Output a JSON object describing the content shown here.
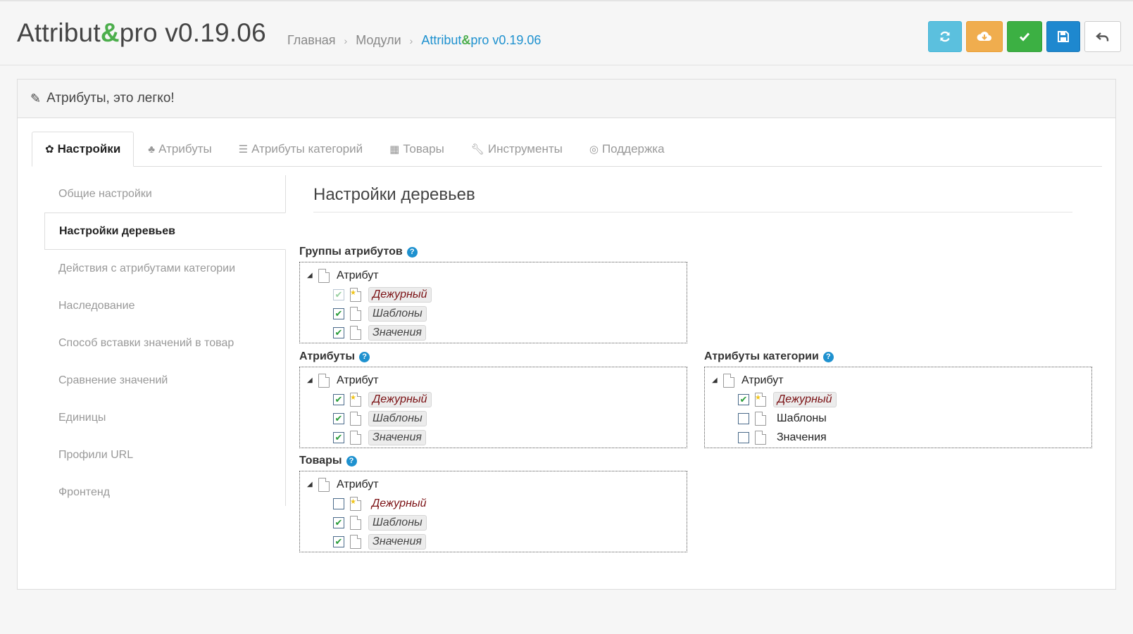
{
  "header": {
    "title_part1": "Attribut",
    "title_amp": "&",
    "title_part2": "pro v0.19.06",
    "breadcrumb": {
      "home": "Главная",
      "modules": "Модули",
      "current_part1": "Attribut",
      "current_amp": "&",
      "current_part2": "pro v0.19.06"
    },
    "toolbar": [
      {
        "icon": "refresh-icon",
        "color": "#5bc0de"
      },
      {
        "icon": "cloud-download-icon",
        "color": "#f0ad4e"
      },
      {
        "icon": "check-icon",
        "color": "#3cb043"
      },
      {
        "icon": "save-icon",
        "color": "#1e88cf"
      },
      {
        "icon": "back-icon",
        "color": "#ffffff"
      }
    ]
  },
  "panel": {
    "heading": "Атрибуты, это легко!"
  },
  "tabs": [
    {
      "label": "Настройки",
      "icon": "gear-icon",
      "active": true
    },
    {
      "label": "Атрибуты",
      "icon": "tree-icon"
    },
    {
      "label": "Атрибуты категорий",
      "icon": "list-icon"
    },
    {
      "label": "Товары",
      "icon": "grid-icon"
    },
    {
      "label": "Инструменты",
      "icon": "wrench-icon"
    },
    {
      "label": "Поддержка",
      "icon": "support-icon"
    }
  ],
  "leftnav": [
    {
      "label": "Общие настройки"
    },
    {
      "label": "Настройки деревьев",
      "active": true
    },
    {
      "label": "Действия с атрибутами категории"
    },
    {
      "label": "Наследование"
    },
    {
      "label": "Способ вставки значений в товар"
    },
    {
      "label": "Сравнение значений"
    },
    {
      "label": "Единицы"
    },
    {
      "label": "Профили URL"
    },
    {
      "label": "Фронтенд"
    }
  ],
  "section_title": "Настройки деревьев",
  "trees": {
    "groups": {
      "label": "Группы атрибутов",
      "root": "Атрибут",
      "items": [
        {
          "text": "Дежурный",
          "checked": true,
          "dim": true
        },
        {
          "text": "Шаблоны",
          "checked": true
        },
        {
          "text": "Значения",
          "checked": true
        }
      ]
    },
    "attributes": {
      "label": "Атрибуты",
      "root": "Атрибут",
      "items": [
        {
          "text": "Дежурный",
          "checked": true
        },
        {
          "text": "Шаблоны",
          "checked": true
        },
        {
          "text": "Значения",
          "checked": true
        }
      ]
    },
    "category_attributes": {
      "label": "Атрибуты категории",
      "root": "Атрибут",
      "items": [
        {
          "text": "Дежурный",
          "checked": true
        },
        {
          "text": "Шаблоны",
          "checked": false
        },
        {
          "text": "Значения",
          "checked": false
        }
      ]
    },
    "products": {
      "label": "Товары",
      "root": "Атрибут",
      "items": [
        {
          "text": "Дежурный",
          "checked": false
        },
        {
          "text": "Шаблоны",
          "checked": true
        },
        {
          "text": "Значения",
          "checked": true
        }
      ]
    }
  }
}
